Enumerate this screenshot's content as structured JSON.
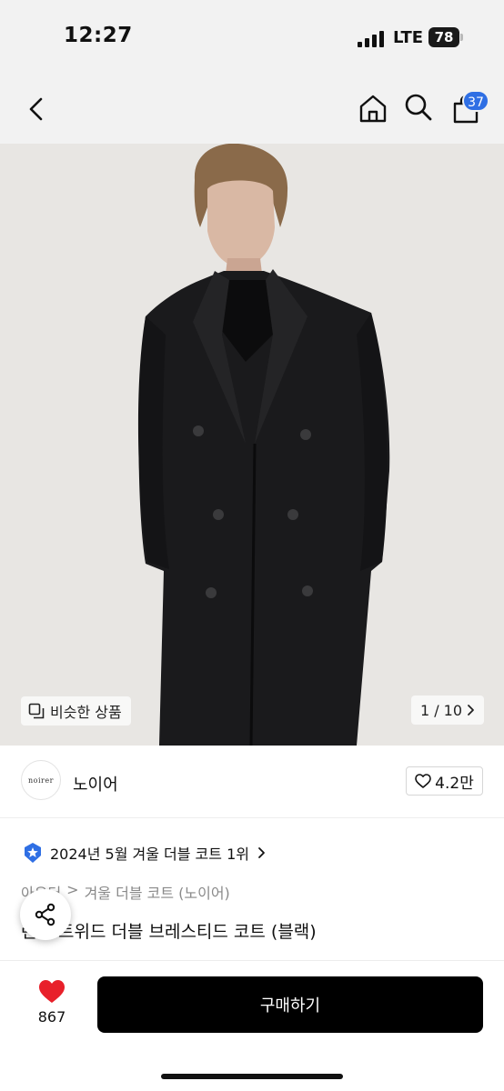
{
  "status_bar": {
    "time": "12:27",
    "network": "LTE",
    "battery": "78"
  },
  "nav": {
    "cart_badge": "37"
  },
  "gallery": {
    "similar_label": "비슷한 상품",
    "page_indicator": "1 / 10"
  },
  "brand": {
    "logo_text": "noirer",
    "name": "노이어",
    "likes": "4.2만"
  },
  "ranking": {
    "text": "2024년 5월 겨울 더블 코트 1위"
  },
  "breadcrumb": {
    "parent": "아우터",
    "current": "겨울 더블 코트 (노이어)"
  },
  "product": {
    "title": "런던 트위드 더블 브레스티드 코트 (블랙)"
  },
  "bottom_bar": {
    "like_count": "867",
    "buy_label": "구매하기"
  },
  "colors": {
    "accent_blue": "#2f6fe4",
    "like_red": "#e8202a",
    "buy_black": "#000000"
  }
}
